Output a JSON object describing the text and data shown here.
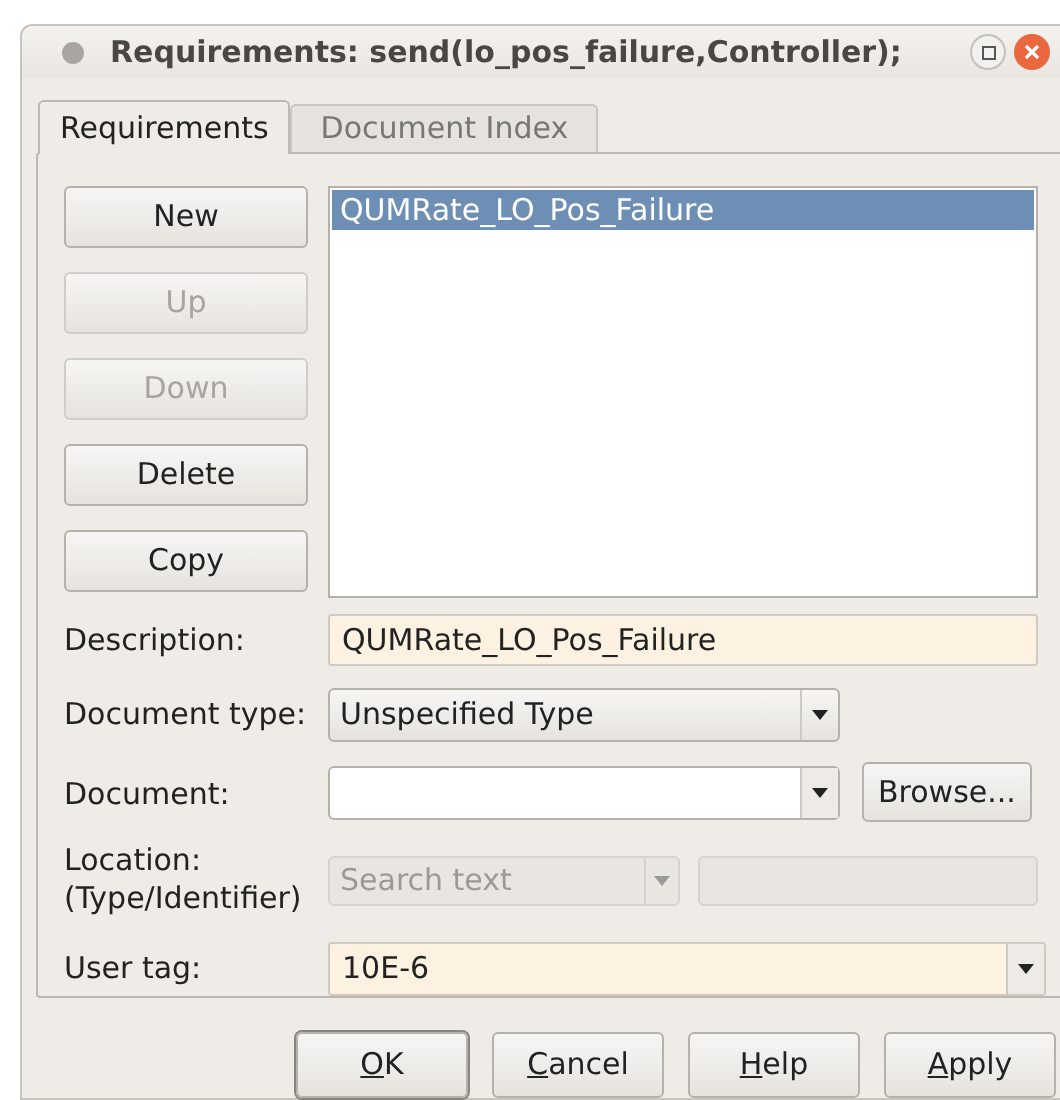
{
  "window": {
    "title": "Requirements: send(lo_pos_failure,Controller);"
  },
  "tabs": [
    {
      "label": "Requirements",
      "selected": true
    },
    {
      "label": "Document Index",
      "selected": false
    }
  ],
  "side_buttons": [
    {
      "label": "New",
      "disabled": false
    },
    {
      "label": "Up",
      "disabled": true
    },
    {
      "label": "Down",
      "disabled": true
    },
    {
      "label": "Delete",
      "disabled": false
    },
    {
      "label": "Copy",
      "disabled": false
    }
  ],
  "requirements_list": [
    {
      "label": "QUMRate_LO_Pos_Failure",
      "selected": true
    }
  ],
  "form": {
    "description": {
      "label": "Description:",
      "value": "QUMRate_LO_Pos_Failure"
    },
    "document_type": {
      "label": "Document type:",
      "value": "Unspecified Type"
    },
    "document": {
      "label": "Document:",
      "button": "Browse..."
    },
    "location": {
      "label": "Location:",
      "label_2": "(Type/Identifier)",
      "placeholder": "Search text",
      "disabled": true
    },
    "user_tag": {
      "label": "User tag:",
      "value": "10E-6"
    }
  },
  "dialog_buttons": [
    {
      "mnemonic": "O",
      "rest": "K",
      "default": true
    },
    {
      "mnemonic": "C",
      "rest": "ancel",
      "default": false
    },
    {
      "mnemonic": "H",
      "rest": "elp",
      "default": false
    },
    {
      "mnemonic": "A",
      "rest": "pply",
      "default": false
    }
  ]
}
